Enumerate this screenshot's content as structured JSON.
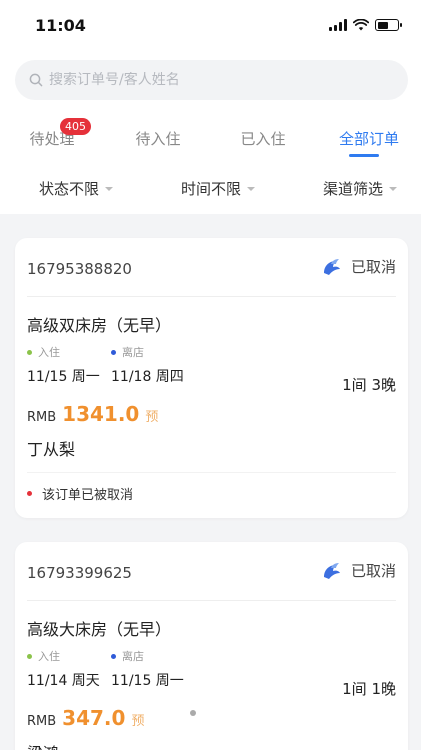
{
  "status_bar": {
    "time": "11:04"
  },
  "search": {
    "placeholder": "搜索订单号/客人姓名"
  },
  "tabs": [
    {
      "label": "待处理",
      "badge": "405"
    },
    {
      "label": "待入住"
    },
    {
      "label": "已入住"
    },
    {
      "label": "全部订单",
      "active": true
    }
  ],
  "filters": [
    {
      "label": "状态不限"
    },
    {
      "label": "时间不限"
    },
    {
      "label": "渠道筛选"
    }
  ],
  "colors": {
    "accent": "#2f7bf0",
    "price": "#f0902e",
    "badge": "#e5313a",
    "checkin_dot": "#8bc34a",
    "checkout_dot": "#2f5bd8",
    "cancel_dot": "#e5313a"
  },
  "orders": [
    {
      "order_no": "16795388820",
      "status_icon": "cancelled-bird-icon",
      "status": "已取消",
      "room": "高级双床房（无早）",
      "checkin_label": "入住",
      "checkout_label": "离店",
      "checkin": "11/15 周一",
      "checkout": "11/18 周四",
      "nights": "1间 3晚",
      "currency": "RMB",
      "amount": "1341.0",
      "tag": "预",
      "guest": "丁从梨",
      "note": "该订单已被取消"
    },
    {
      "order_no": "16793399625",
      "status_icon": "cancelled-bird-icon",
      "status": "已取消",
      "room": "高级大床房（无早）",
      "checkin_label": "入住",
      "checkout_label": "离店",
      "checkin": "11/14 周天",
      "checkout": "11/15 周一",
      "nights": "1间 1晚",
      "currency": "RMB",
      "amount": "347.0",
      "tag": "预",
      "guest": "梁鸿"
    }
  ]
}
